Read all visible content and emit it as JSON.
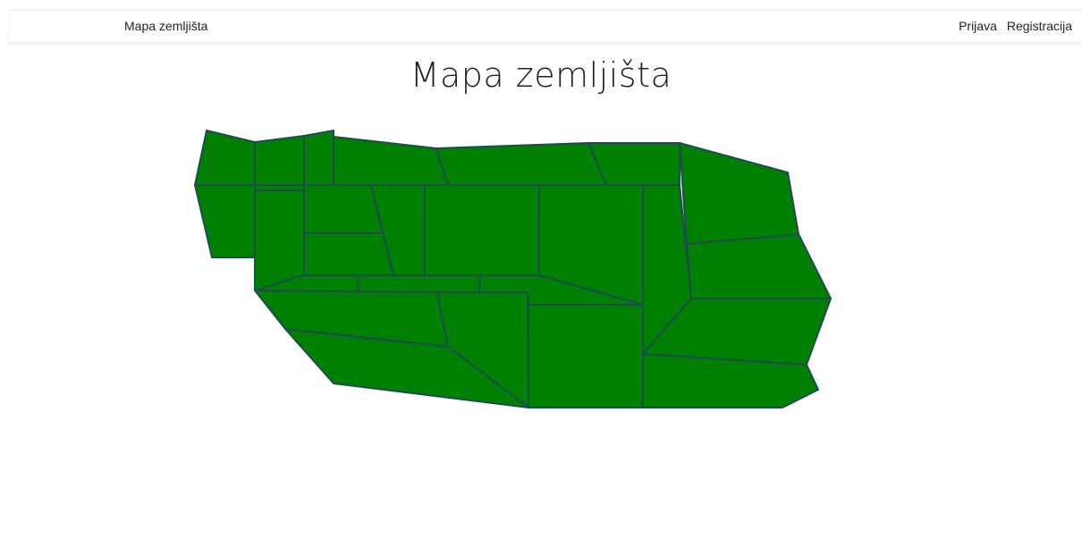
{
  "navbar": {
    "brand": "Mapa zemljišta",
    "links": [
      {
        "label": "Prijava"
      },
      {
        "label": "Registracija"
      }
    ]
  },
  "page": {
    "title": "Mapa zemljišta"
  },
  "map": {
    "parcel_fill": "#008000",
    "parcel_stroke": "#1f4a4f",
    "parcel_count": 27
  }
}
